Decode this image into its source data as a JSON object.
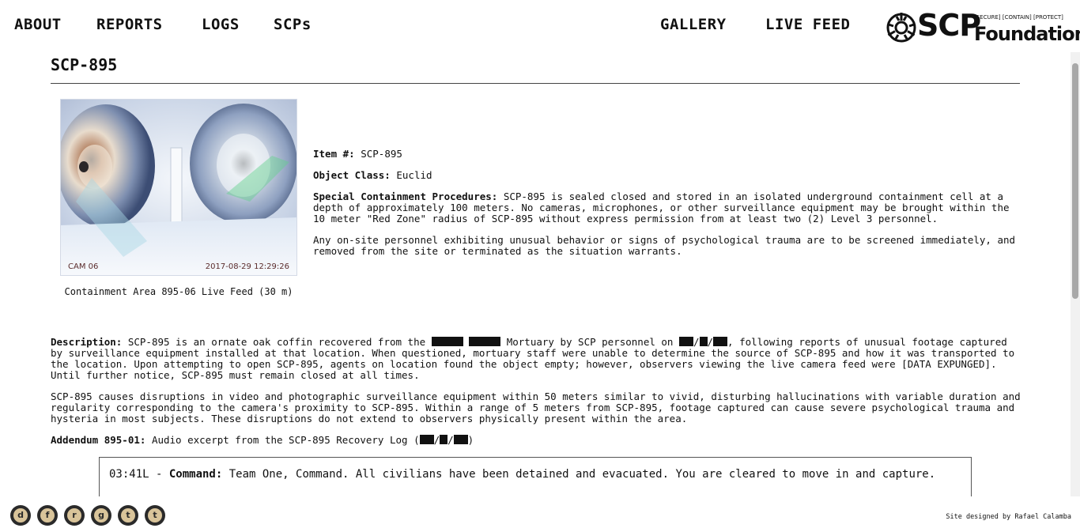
{
  "nav": {
    "left": [
      "ABOUT",
      "REPORTS",
      "LOGS",
      "SCPs"
    ],
    "right": [
      "GALLERY",
      "LIVE FEED"
    ]
  },
  "logo": {
    "scp": "SCP",
    "foundation": "Foundation",
    "tagline": "[SECURE] [CONTAIN] [PROTECT]"
  },
  "page": {
    "title": "SCP-895"
  },
  "camera": {
    "label": "CAM 06",
    "timestamp": "2017-08-29 12:29:26",
    "caption": "Containment Area 895-06 Live Feed (30 m)"
  },
  "item": {
    "number_label": "Item #:",
    "number": "SCP-895",
    "class_label": "Object Class:",
    "class": "Euclid",
    "procedures_label": "Special Containment Procedures:",
    "procedures": "SCP-895 is sealed closed and stored in an isolated underground containment cell at a depth of approximately 100 meters. No cameras, microphones, or other surveillance equipment may be brought within the 10 meter \"Red Zone\" radius of SCP-895 without express permission from at least two (2) Level 3 personnel.",
    "procedures_2": "Any on-site personnel exhibiting unusual behavior or signs of psychological trauma are to be screened immediately, and removed from the site or terminated as the situation warrants."
  },
  "description": {
    "label": "Description:",
    "part1": "SCP-895 is an ornate oak coffin recovered from the",
    "part2": "Mortuary by SCP personnel on",
    "part3": ", following reports of unusual footage captured by surveillance equipment installed at that location. When questioned, mortuary staff were unable to determine the source of SCP-895 and how it was transported to the location. Upon attempting to open SCP-895, agents on location found the object empty; however, observers viewing the live camera feed were [DATA EXPUNGED]. Until further notice, SCP-895 must remain closed at all times.",
    "paragraph2": "SCP-895 causes disruptions in video and photographic surveillance equipment within 50 meters similar to vivid, disturbing hallucinations with variable duration and regularity corresponding to the camera's proximity to SCP-895. Within a range of 5 meters from SCP-895, footage captured can cause severe psychological trauma and hysteria in most subjects. These disruptions do not extend to observers physically present within the area."
  },
  "addendum": {
    "label": "Addendum 895-01:",
    "text": "Audio excerpt from the SCP-895 Recovery Log ("
  },
  "log": {
    "time": "03:41L - ",
    "speaker": "Command:",
    "text": " Team One, Command. All civilians have been detained and evacuated. You are cleared to move in and capture."
  },
  "footer": {
    "social_icons": [
      "discord-icon",
      "facebook-icon",
      "reddit-icon",
      "github-icon",
      "tumblr-icon",
      "twitter-icon"
    ],
    "social_glyphs": [
      "d",
      "f",
      "r",
      "g",
      "t",
      "t"
    ],
    "credit": "Site designed by Rafael Calamba"
  }
}
